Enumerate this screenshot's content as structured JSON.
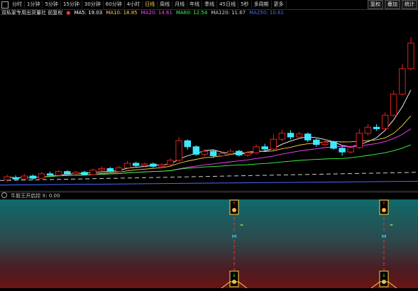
{
  "toolbar": {
    "items": [
      "分时",
      "1分钟",
      "5分钟",
      "15分钟",
      "30分钟",
      "60分钟",
      "4小时",
      "日线",
      "周线",
      "月线",
      "年线",
      "季线",
      "45日线",
      "5秒",
      "多周期",
      "更多"
    ],
    "active_index": 7,
    "buttons": [
      "复权",
      "叠加",
      "统计"
    ]
  },
  "legend": {
    "title": "双私家专用出货量社 前复权",
    "items": [
      {
        "label": "MA5: 19.03",
        "color": "#ffffff"
      },
      {
        "label": "MA10: 18.85",
        "color": "#ffd24a"
      },
      {
        "label": "MA20: 14.61",
        "color": "#ff44ff"
      },
      {
        "label": "MA60: 12.54",
        "color": "#3cff3c"
      },
      {
        "label": "MA120: 11.67",
        "color": "#cfcfcf"
      },
      {
        "label": "MA250: 10.61",
        "color": "#4a6bff"
      }
    ]
  },
  "subchart": {
    "title": "牛股王开启控 X: 0.00"
  },
  "colors": {
    "up": "#e02020",
    "down": "#3ee8ff",
    "accent": "#ffd24a"
  },
  "chart_data": {
    "type": "candlestick",
    "candles": [
      {
        "o": 8.2,
        "c": 8.6,
        "h": 8.9,
        "l": 7.9
      },
      {
        "o": 8.5,
        "c": 8.3,
        "h": 8.8,
        "l": 8.1
      },
      {
        "o": 8.3,
        "c": 8.7,
        "h": 9.0,
        "l": 8.2
      },
      {
        "o": 8.7,
        "c": 8.4,
        "h": 8.9,
        "l": 8.2
      },
      {
        "o": 8.4,
        "c": 9.0,
        "h": 9.2,
        "l": 8.3
      },
      {
        "o": 9.0,
        "c": 8.8,
        "h": 9.3,
        "l": 8.6
      },
      {
        "o": 8.8,
        "c": 9.3,
        "h": 9.5,
        "l": 8.7
      },
      {
        "o": 9.3,
        "c": 9.0,
        "h": 9.5,
        "l": 8.9
      },
      {
        "o": 9.0,
        "c": 9.2,
        "h": 9.4,
        "l": 8.8
      },
      {
        "o": 9.2,
        "c": 8.9,
        "h": 9.4,
        "l": 8.8
      },
      {
        "o": 8.9,
        "c": 9.5,
        "h": 9.7,
        "l": 8.8
      },
      {
        "o": 9.5,
        "c": 9.7,
        "h": 10.0,
        "l": 9.3
      },
      {
        "o": 9.7,
        "c": 9.3,
        "h": 9.9,
        "l": 9.2
      },
      {
        "o": 9.3,
        "c": 9.8,
        "h": 10.1,
        "l": 9.2
      },
      {
        "o": 9.8,
        "c": 10.4,
        "h": 10.7,
        "l": 9.6
      },
      {
        "o": 10.4,
        "c": 10.1,
        "h": 10.6,
        "l": 9.9
      },
      {
        "o": 10.1,
        "c": 10.3,
        "h": 10.5,
        "l": 9.9
      },
      {
        "o": 10.3,
        "c": 10.0,
        "h": 10.5,
        "l": 9.8
      },
      {
        "o": 10.0,
        "c": 10.2,
        "h": 10.4,
        "l": 9.8
      },
      {
        "o": 10.2,
        "c": 10.8,
        "h": 11.1,
        "l": 10.0
      },
      {
        "o": 10.8,
        "c": 13.4,
        "h": 13.9,
        "l": 10.6
      },
      {
        "o": 13.4,
        "c": 12.6,
        "h": 13.6,
        "l": 12.2
      },
      {
        "o": 12.6,
        "c": 11.6,
        "h": 12.8,
        "l": 11.4
      },
      {
        "o": 11.6,
        "c": 12.0,
        "h": 12.3,
        "l": 11.3
      },
      {
        "o": 12.0,
        "c": 11.4,
        "h": 12.2,
        "l": 11.1
      },
      {
        "o": 11.4,
        "c": 11.7,
        "h": 12.0,
        "l": 11.2
      },
      {
        "o": 11.7,
        "c": 12.0,
        "h": 12.3,
        "l": 11.5
      },
      {
        "o": 12.0,
        "c": 11.5,
        "h": 12.2,
        "l": 11.3
      },
      {
        "o": 11.5,
        "c": 11.8,
        "h": 12.0,
        "l": 11.3
      },
      {
        "o": 11.8,
        "c": 12.6,
        "h": 12.9,
        "l": 11.6
      },
      {
        "o": 12.6,
        "c": 12.3,
        "h": 13.0,
        "l": 12.1
      },
      {
        "o": 12.3,
        "c": 13.6,
        "h": 14.3,
        "l": 12.1
      },
      {
        "o": 13.6,
        "c": 14.4,
        "h": 14.9,
        "l": 13.3
      },
      {
        "o": 14.4,
        "c": 13.9,
        "h": 14.8,
        "l": 13.6
      },
      {
        "o": 13.9,
        "c": 14.3,
        "h": 14.6,
        "l": 13.7
      },
      {
        "o": 14.3,
        "c": 13.5,
        "h": 14.5,
        "l": 13.2
      },
      {
        "o": 13.5,
        "c": 12.9,
        "h": 13.7,
        "l": 12.6
      },
      {
        "o": 12.9,
        "c": 13.2,
        "h": 13.6,
        "l": 12.7
      },
      {
        "o": 13.2,
        "c": 12.4,
        "h": 13.4,
        "l": 12.2
      },
      {
        "o": 12.4,
        "c": 11.9,
        "h": 12.6,
        "l": 11.4
      },
      {
        "o": 11.9,
        "c": 12.5,
        "h": 12.8,
        "l": 11.7
      },
      {
        "o": 12.5,
        "c": 14.4,
        "h": 15.0,
        "l": 12.3
      },
      {
        "o": 14.4,
        "c": 15.2,
        "h": 15.6,
        "l": 14.1
      },
      {
        "o": 15.2,
        "c": 15.0,
        "h": 15.6,
        "l": 14.7
      },
      {
        "o": 15.0,
        "c": 16.8,
        "h": 17.2,
        "l": 14.8
      },
      {
        "o": 16.8,
        "c": 19.6,
        "h": 20.1,
        "l": 16.6
      },
      {
        "o": 19.6,
        "c": 23.0,
        "h": 23.6,
        "l": 19.4
      },
      {
        "o": 23.0,
        "c": 26.4,
        "h": 27.2,
        "l": 22.8
      }
    ],
    "ylim": [
      7.0,
      29.5
    ]
  }
}
